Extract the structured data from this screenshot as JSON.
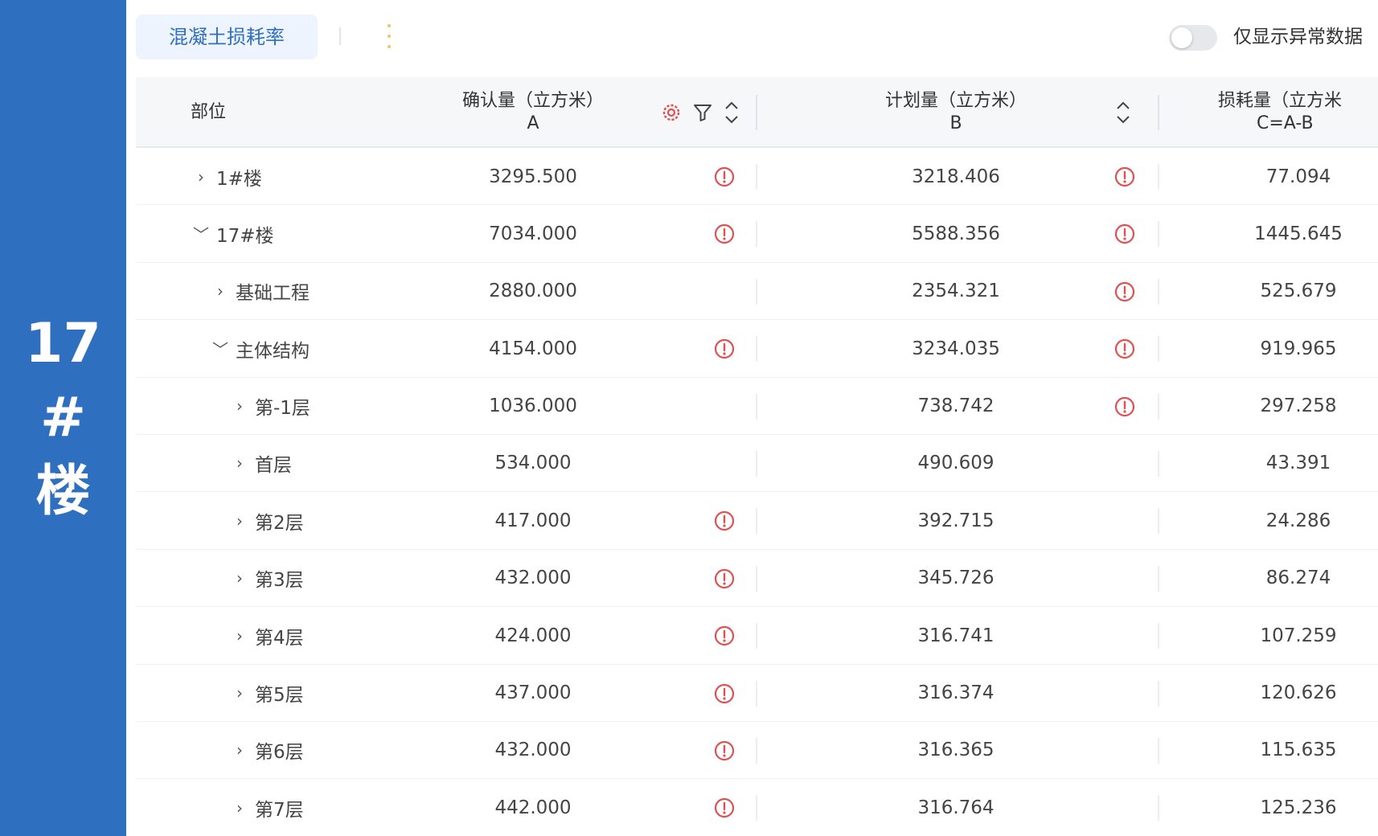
{
  "banner": {
    "line1": "17",
    "line2": "#",
    "line3": "楼"
  },
  "toolbar": {
    "active_tab": "混凝土损耗率",
    "toggle_label": "仅显示异常数据",
    "toggle_on": false
  },
  "colors": {
    "accent": "#2f6fc0",
    "warning": "#e05050"
  },
  "table": {
    "headers": {
      "location": "部位",
      "confirmed_line1": "确认量（立方米）",
      "confirmed_line2": "A",
      "planned_line1": "计划量（立方米）",
      "planned_line2": "B",
      "loss_line1": "损耗量（立方米",
      "loss_line2": "C=A-B"
    },
    "rows": [
      {
        "name": "1#楼",
        "expanded": false,
        "level": 0,
        "confirmed": "3295.500",
        "confirmed_warn": true,
        "planned": "3218.406",
        "planned_warn": true,
        "loss": "77.094"
      },
      {
        "name": "17#楼",
        "expanded": true,
        "level": 0,
        "confirmed": "7034.000",
        "confirmed_warn": true,
        "planned": "5588.356",
        "planned_warn": true,
        "loss": "1445.645"
      },
      {
        "name": "基础工程",
        "expanded": false,
        "level": 1,
        "confirmed": "2880.000",
        "confirmed_warn": false,
        "planned": "2354.321",
        "planned_warn": true,
        "loss": "525.679"
      },
      {
        "name": "主体结构",
        "expanded": true,
        "level": 1,
        "confirmed": "4154.000",
        "confirmed_warn": true,
        "planned": "3234.035",
        "planned_warn": true,
        "loss": "919.965"
      },
      {
        "name": "第-1层",
        "expanded": false,
        "level": 2,
        "confirmed": "1036.000",
        "confirmed_warn": false,
        "planned": "738.742",
        "planned_warn": true,
        "loss": "297.258"
      },
      {
        "name": "首层",
        "expanded": false,
        "level": 2,
        "confirmed": "534.000",
        "confirmed_warn": false,
        "planned": "490.609",
        "planned_warn": false,
        "loss": "43.391"
      },
      {
        "name": "第2层",
        "expanded": false,
        "level": 2,
        "confirmed": "417.000",
        "confirmed_warn": true,
        "planned": "392.715",
        "planned_warn": false,
        "loss": "24.286"
      },
      {
        "name": "第3层",
        "expanded": false,
        "level": 2,
        "confirmed": "432.000",
        "confirmed_warn": true,
        "planned": "345.726",
        "planned_warn": false,
        "loss": "86.274"
      },
      {
        "name": "第4层",
        "expanded": false,
        "level": 2,
        "confirmed": "424.000",
        "confirmed_warn": true,
        "planned": "316.741",
        "planned_warn": false,
        "loss": "107.259"
      },
      {
        "name": "第5层",
        "expanded": false,
        "level": 2,
        "confirmed": "437.000",
        "confirmed_warn": true,
        "planned": "316.374",
        "planned_warn": false,
        "loss": "120.626"
      },
      {
        "name": "第6层",
        "expanded": false,
        "level": 2,
        "confirmed": "432.000",
        "confirmed_warn": true,
        "planned": "316.365",
        "planned_warn": false,
        "loss": "115.635"
      },
      {
        "name": "第7层",
        "expanded": false,
        "level": 2,
        "confirmed": "442.000",
        "confirmed_warn": true,
        "planned": "316.764",
        "planned_warn": false,
        "loss": "125.236"
      }
    ]
  }
}
